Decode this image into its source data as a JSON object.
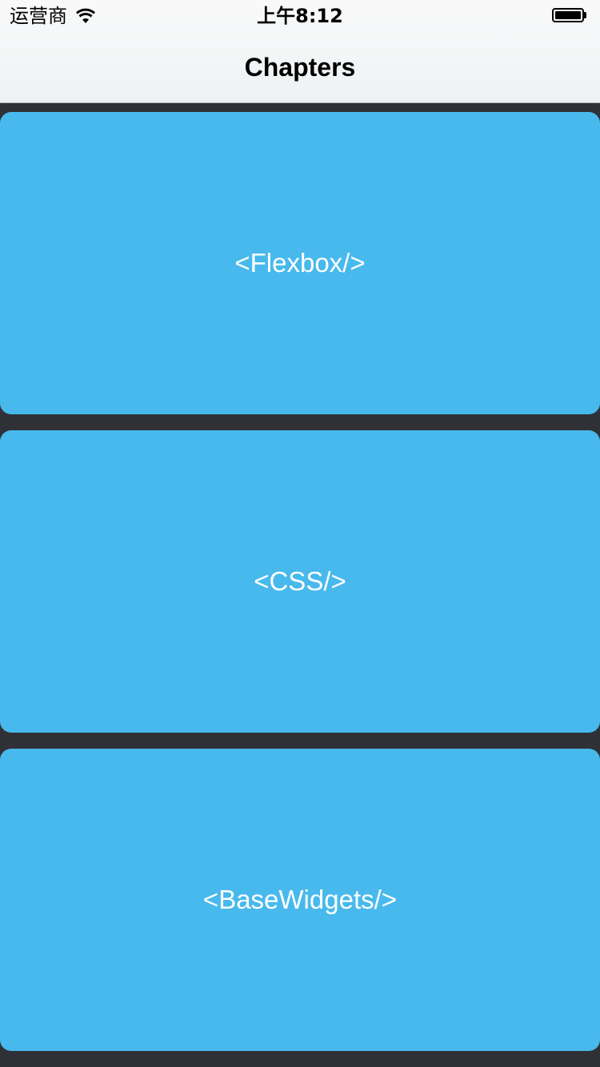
{
  "status_bar": {
    "carrier": "运营商",
    "wifi_icon": "wifi-icon",
    "time": "上午8:12",
    "battery_icon": "battery-full-icon"
  },
  "nav": {
    "title": "Chapters"
  },
  "chapters": [
    {
      "label": "<Flexbox/>"
    },
    {
      "label": "<CSS/>"
    },
    {
      "label": "<BaseWidgets/>"
    }
  ],
  "colors": {
    "card_background": "#48b9ec",
    "page_background": "#2f3136",
    "card_text": "#ffffff"
  }
}
